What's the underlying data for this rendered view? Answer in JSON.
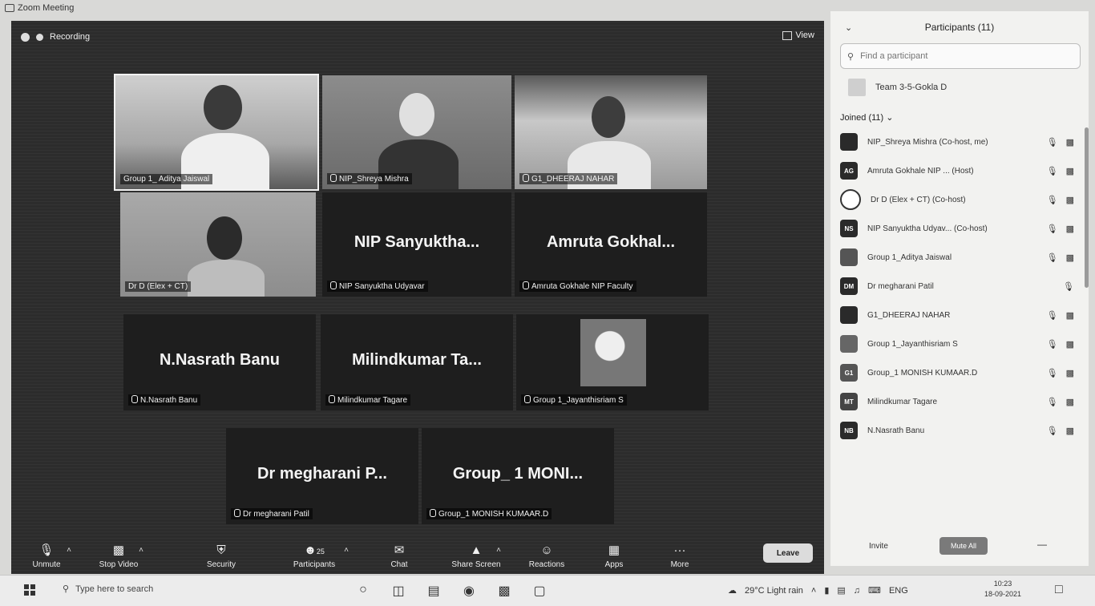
{
  "window": {
    "title": "Zoom Meeting"
  },
  "meeting": {
    "recording_label": "Recording",
    "view_label": "View",
    "tiles": [
      {
        "label": "Group 1_ Aditya Jaiswal",
        "big": ""
      },
      {
        "label": "NIP_Shreya Mishra",
        "big": ""
      },
      {
        "label": "G1_DHEERAJ NAHAR",
        "big": ""
      },
      {
        "label": "Dr D (Elex + CT)",
        "big": ""
      },
      {
        "label": "NIP Sanyuktha Udyavar",
        "big": "NIP Sanyuktha..."
      },
      {
        "label": "Amruta Gokhale NIP Faculty",
        "big": "Amruta Gokhal..."
      },
      {
        "label": "N.Nasrath Banu",
        "big": "N.Nasrath Banu"
      },
      {
        "label": "Milindkumar Tagare",
        "big": "Milindkumar Ta..."
      },
      {
        "label": "Group 1_Jayanthisriam S",
        "big": ""
      },
      {
        "label": "Dr megharani Patil",
        "big": "Dr megharani P..."
      },
      {
        "label": "Group_1 MONISH KUMAAR.D",
        "big": "Group_ 1 MONI..."
      }
    ]
  },
  "toolbar": {
    "unmute": "Unmute",
    "stop_video": "Stop Video",
    "security": "Security",
    "participants": "Participants",
    "participants_count": "25",
    "chat": "Chat",
    "share_screen": "Share Screen",
    "reactions": "Reactions",
    "apps": "Apps",
    "more": "More",
    "leave": "Leave"
  },
  "panel": {
    "title": "Participants (11)",
    "search_placeholder": "Find a participant",
    "team": "Team 3-5-Gokla D",
    "joined": "Joined (11)",
    "participants": [
      {
        "initials": "",
        "name": "NIP_Shreya Mishra (Co-host, me)"
      },
      {
        "initials": "AG",
        "name": "Amruta Gokhale NIP ... (Host)"
      },
      {
        "initials": "",
        "name": "Dr D (Elex + CT) (Co-host)"
      },
      {
        "initials": "NS",
        "name": "NIP Sanyuktha Udyav... (Co-host)"
      },
      {
        "initials": "",
        "name": "Group 1_Aditya Jaiswal"
      },
      {
        "initials": "DM",
        "name": "Dr megharani Patil"
      },
      {
        "initials": "",
        "name": "G1_DHEERAJ NAHAR"
      },
      {
        "initials": "",
        "name": "Group 1_Jayanthisriam S"
      },
      {
        "initials": "G1",
        "name": "Group_1 MONISH KUMAAR.D"
      },
      {
        "initials": "MT",
        "name": "Milindkumar Tagare"
      },
      {
        "initials": "NB",
        "name": "N.Nasrath Banu"
      }
    ],
    "invite": "Invite",
    "mute_all": "Mute All"
  },
  "taskbar": {
    "search_placeholder": "Type here to search",
    "weather": "29°C  Light rain",
    "lang": "ENG",
    "time": "10:23",
    "date": "18-09-2021"
  }
}
